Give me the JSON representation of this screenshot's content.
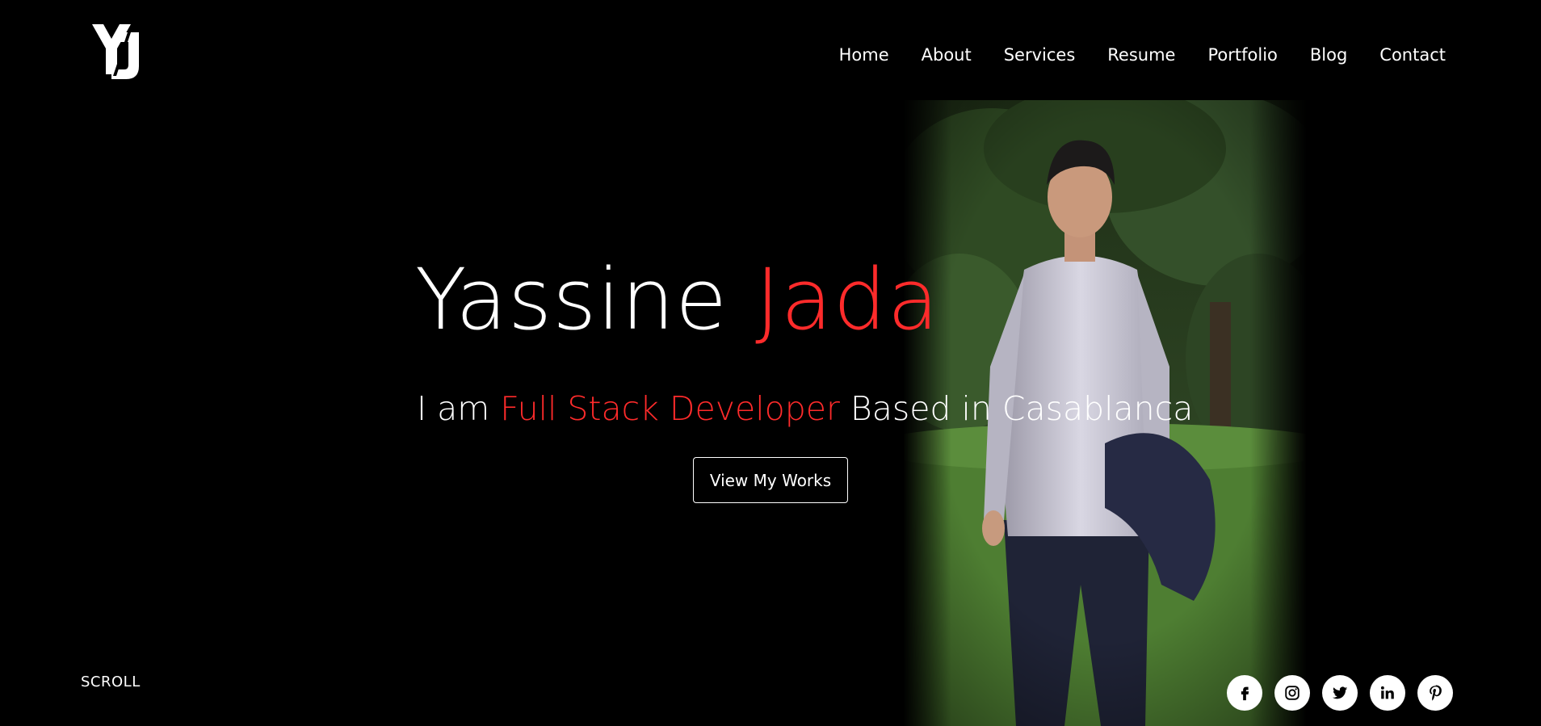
{
  "header": {
    "logo_text": "YJ",
    "nav": [
      {
        "label": "Home"
      },
      {
        "label": "About"
      },
      {
        "label": "Services"
      },
      {
        "label": "Resume"
      },
      {
        "label": "Portfolio"
      },
      {
        "label": "Blog"
      },
      {
        "label": "Contact"
      }
    ]
  },
  "hero": {
    "first_name": "Yassine",
    "last_name": "Jada",
    "tagline_prefix": "I am",
    "tagline_role": "Full Stack Developer",
    "tagline_suffix": "Based in Casablanca",
    "cta_label": "View My Works",
    "accent_color": "#ff2b2b"
  },
  "scroll_label": "SCROLL",
  "social": [
    {
      "icon": "facebook-icon"
    },
    {
      "icon": "instagram-icon"
    },
    {
      "icon": "twitter-icon"
    },
    {
      "icon": "linkedin-icon"
    },
    {
      "icon": "pinterest-icon"
    }
  ]
}
